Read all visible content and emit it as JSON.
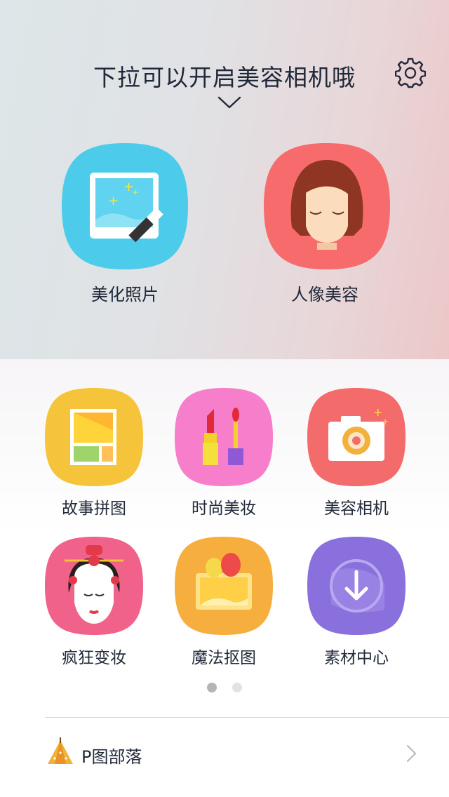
{
  "header": {
    "pull_hint": "下拉可以开启美容相机哦",
    "settings_icon": "gear-icon",
    "expand_icon": "chevron-down-icon"
  },
  "main_features": [
    {
      "label": "美化照片",
      "icon": "photo-magic-wand-icon",
      "color": "#4dcbea"
    },
    {
      "label": "人像美容",
      "icon": "portrait-face-icon",
      "color": "#f76b6c"
    }
  ],
  "grid": [
    {
      "label": "故事拼图",
      "icon": "collage-icon",
      "color": "#f6c43a"
    },
    {
      "label": "时尚美妆",
      "icon": "lipstick-icon",
      "color": "#f77ecb"
    },
    {
      "label": "美容相机",
      "icon": "camera-icon",
      "color": "#f46b6b"
    },
    {
      "label": "疯狂变妆",
      "icon": "opera-face-icon",
      "color": "#f0628a"
    },
    {
      "label": "魔法抠图",
      "icon": "balloon-picture-icon",
      "color": "#f6ae3e"
    },
    {
      "label": "素材中心",
      "icon": "download-icon",
      "color": "#8a70dc"
    }
  ],
  "pager": {
    "current": 1,
    "total": 2
  },
  "tribe": {
    "label": "P图部落",
    "icon": "tent-icon",
    "arrow_icon": "chevron-right-icon"
  }
}
